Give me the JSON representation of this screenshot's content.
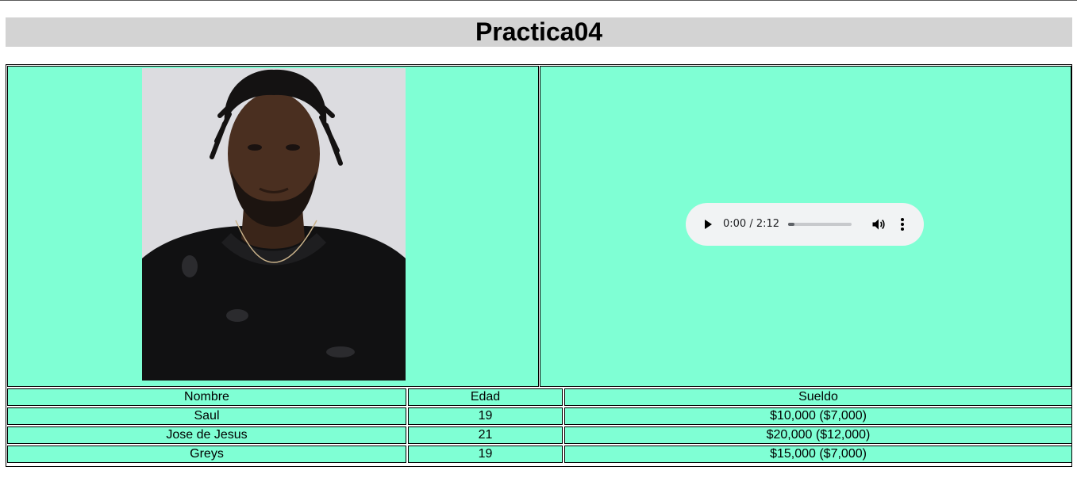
{
  "page": {
    "title": "Practica04"
  },
  "media": {
    "photo_icon": "portrait-photo",
    "audio": {
      "time": "0:00 / 2:12",
      "progress": 0.1,
      "play_icon": "play-icon",
      "volume_icon": "volume-icon",
      "menu_icon": "more-vert-icon"
    }
  },
  "table": {
    "headers": [
      "Nombre",
      "Edad",
      "Sueldo"
    ],
    "rows": [
      [
        "Saul",
        "19",
        "$10,000 ($7,000)"
      ],
      [
        "Jose de Jesus",
        "21",
        "$20,000 ($12,000)"
      ],
      [
        "Greys",
        "19",
        "$15,000 ($7,000)"
      ]
    ]
  },
  "colors": {
    "cell_bg": "#7fffd4",
    "title_bg": "#d3d3d3",
    "player_bg": "#f1f3f4"
  }
}
